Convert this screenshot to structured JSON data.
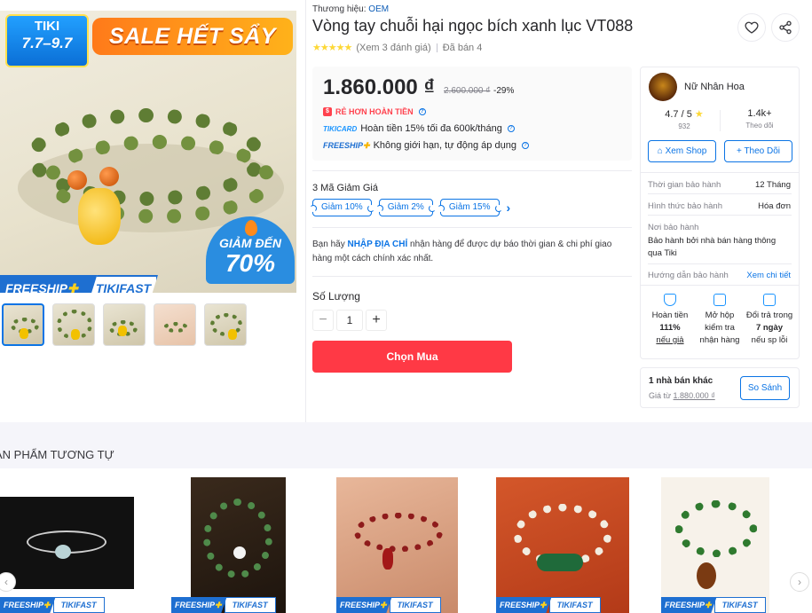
{
  "gallery": {
    "badge_line1": "TIKI",
    "badge_line2": "7.7–9.7",
    "sale_text": "SALE HẾT SẨY",
    "promo_line1": "GIẢM ĐẾN",
    "promo_line2": "70%",
    "freeship": "FREESHIP",
    "tikifast": "TIKIFAST"
  },
  "product": {
    "brand_label": "Thương hiệu:",
    "brand_name": "OEM",
    "title": "Vòng tay chuỗi hại ngọc bích xanh lục VT088",
    "stars": "★★★★★",
    "reviews": "(Xem 3 đánh giá)",
    "sold": "Đã bán 4",
    "price": "1.860.000 ₫",
    "old_price": "2.600.000 ₫",
    "discount": "-29%",
    "cheaper_badge": "$",
    "cheaper_text": "RẺ HƠN HOÀN TIỀN",
    "tikicard_logo": "TIKICARD",
    "tikicard_text": "Hoàn tiền 15% tối đa 600k/tháng",
    "freeship_logo": "FREESHIP",
    "freeship_text": "Không giới hạn, tự động áp dụng"
  },
  "vouchers": {
    "title": "3 Mã Giảm Giá",
    "items": [
      "Giảm 10%",
      "Giảm 2%",
      "Giảm 15%"
    ]
  },
  "delivery": {
    "before": "Bạn hãy ",
    "link": "NHẬP ĐỊA CHỈ",
    "after": " nhận hàng để được dự báo thời gian & chi phí giao hàng một cách chính xác nhất."
  },
  "quantity": {
    "label": "Số Lượng",
    "minus": "−",
    "value": "1",
    "plus": "+"
  },
  "buy_button": "Chọn Mua",
  "seller": {
    "name": "Nữ Nhân Hoa",
    "rating": "4.7 / 5",
    "rating_star": "★",
    "rating_count": "932",
    "followers": "1.4k+",
    "followers_label": "Theo dõi",
    "view_shop": "Xem Shop",
    "follow": "Theo Dõi",
    "warranty_time_label": "Thời gian bảo hành",
    "warranty_time": "12 Tháng",
    "warranty_form_label": "Hình thức bảo hành",
    "warranty_form": "Hóa đơn",
    "warranty_place_label": "Nơi bảo hành",
    "warranty_place": "Bảo hành bởi nhà bán hàng thông qua Tiki",
    "warranty_guide_label": "Hướng dẫn bảo hành",
    "warranty_guide_link": "Xem chi tiết",
    "g1_line1": "Hoàn tiền",
    "g1_bold": "111%",
    "g1_link": "nếu giả",
    "g2_line1": "Mở hộp",
    "g2_line2": "kiểm tra",
    "g2_line3": "nhận hàng",
    "g3_line1": "Đổi trả trong",
    "g3_bold": "7 ngày",
    "g3_line3": "nếu sp lỗi"
  },
  "other_sellers": {
    "title": "1 nhà bán khác",
    "price_prefix": "Giá từ ",
    "price": "1.880.000 ₫",
    "compare": "So Sánh"
  },
  "similar": {
    "title": "ẢN PHẨM TƯƠNG TỰ",
    "freeship": "FREESHIP",
    "tikifast": "TIKIFAST"
  },
  "colors": {
    "accent": "#0b74e5",
    "buy": "#ff3945",
    "star": "#fdd836"
  }
}
